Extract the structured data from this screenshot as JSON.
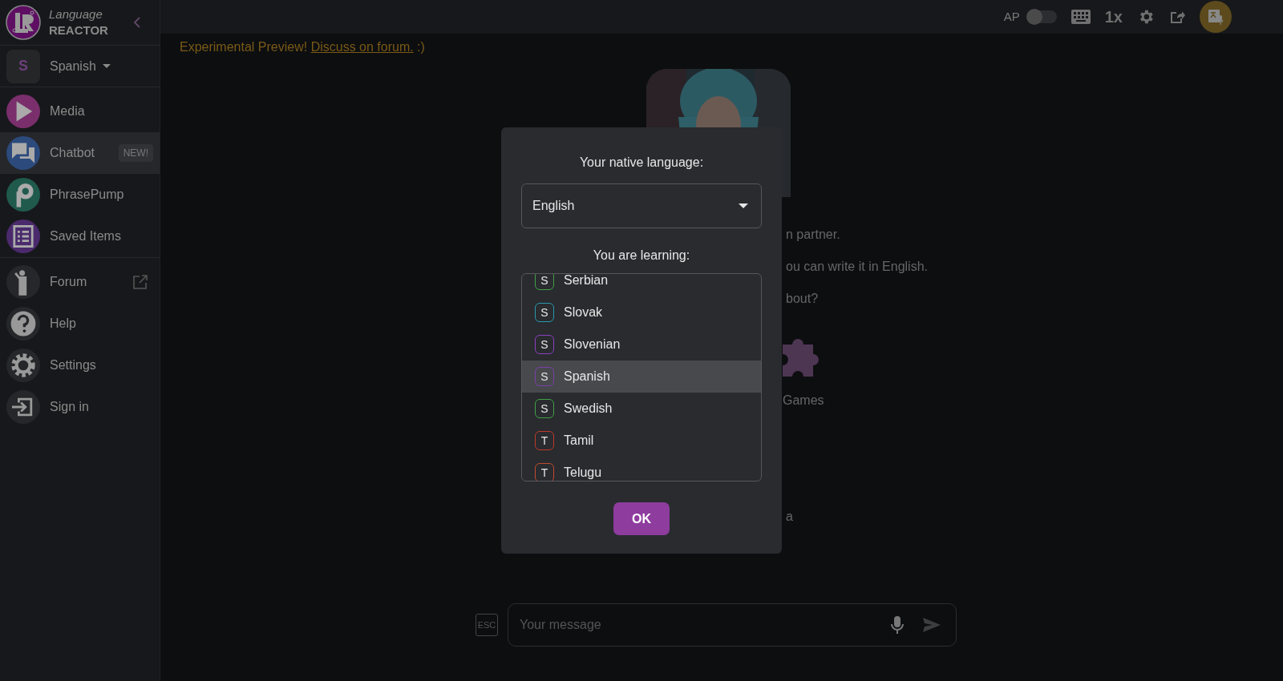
{
  "logo": {
    "line1": "Language",
    "line2": "REACTOR"
  },
  "language_selector": {
    "letter": "S",
    "label": "Spanish"
  },
  "nav_items": [
    {
      "kind": "media",
      "label": "Media",
      "selected": false
    },
    {
      "kind": "chatbot",
      "label": "Chatbot",
      "badge": "NEW!",
      "selected": true
    },
    {
      "kind": "phrasepump",
      "label": "PhrasePump",
      "selected": false
    },
    {
      "kind": "saved",
      "label": "Saved Items",
      "selected": false
    }
  ],
  "secondary_items": [
    {
      "kind": "forum",
      "label": "Forum",
      "external": true
    },
    {
      "kind": "help",
      "label": "Help",
      "external": false
    },
    {
      "kind": "settings",
      "label": "Settings",
      "external": false
    },
    {
      "kind": "signin",
      "label": "Sign in",
      "external": false
    }
  ],
  "top_bar": {
    "ap_label": "AP",
    "ap_on": false,
    "speed": "1x"
  },
  "banner": {
    "text": "Experimental Preview!",
    "link": "Discuss on forum.",
    "suffix": ":)"
  },
  "background_texts": [
    "n partner.",
    "ou can write it in English.",
    "bout?"
  ],
  "background_card": {
    "label": "Games"
  },
  "background_tail": "a",
  "dialog": {
    "native_label": "Your native language:",
    "native_value": "English",
    "learning_label": "You are learning:",
    "ok": "OK",
    "languages": [
      {
        "letter": "S",
        "name": "Serbian",
        "color": "#43a047",
        "selected": false
      },
      {
        "letter": "S",
        "name": "Slovak",
        "color": "#2a98ad",
        "selected": false
      },
      {
        "letter": "S",
        "name": "Slovenian",
        "color": "#8e3fbf",
        "selected": false
      },
      {
        "letter": "S",
        "name": "Spanish",
        "color": "#7d3fa8",
        "selected": true
      },
      {
        "letter": "S",
        "name": "Swedish",
        "color": "#43a047",
        "selected": false
      },
      {
        "letter": "T",
        "name": "Tamil",
        "color": "#c0392b",
        "selected": false
      },
      {
        "letter": "T",
        "name": "Telugu",
        "color": "#c24a2e",
        "selected": false
      }
    ]
  },
  "composer": {
    "esc": "ESC",
    "placeholder": "Your message"
  }
}
